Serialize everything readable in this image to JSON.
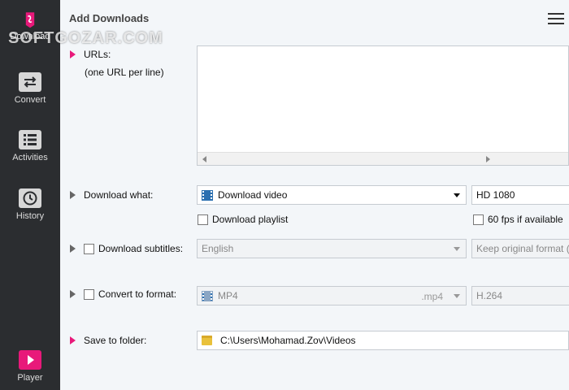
{
  "sidebar": {
    "items": [
      {
        "label": "Download",
        "icon": "download-icon"
      },
      {
        "label": "Convert",
        "icon": "convert-icon"
      },
      {
        "label": "Activities",
        "icon": "activities-icon"
      },
      {
        "label": "History",
        "icon": "history-icon"
      },
      {
        "label": "Player",
        "icon": "player-icon"
      }
    ]
  },
  "header": {
    "title": "Add Downloads"
  },
  "urls": {
    "label": "URLs:",
    "hint": "(one URL per line)",
    "value": ""
  },
  "download_what": {
    "label": "Download what:",
    "selected": "Download video",
    "quality": "HD 1080",
    "playlist_label": "Download playlist",
    "fps_label": "60 fps if available"
  },
  "subtitles": {
    "label": "Download subtitles:",
    "language": "English",
    "format": "Keep original format ("
  },
  "convert": {
    "label": "Convert to format:",
    "format": "MP4",
    "ext": ".mp4",
    "codec": "H.264"
  },
  "save": {
    "label": "Save to folder:",
    "path": "C:\\Users\\Mohamad.Zov\\Videos"
  },
  "watermark": "SOFTGOZAR.COM",
  "colors": {
    "accent": "#e8197a",
    "sidebar": "#2b2d30"
  }
}
